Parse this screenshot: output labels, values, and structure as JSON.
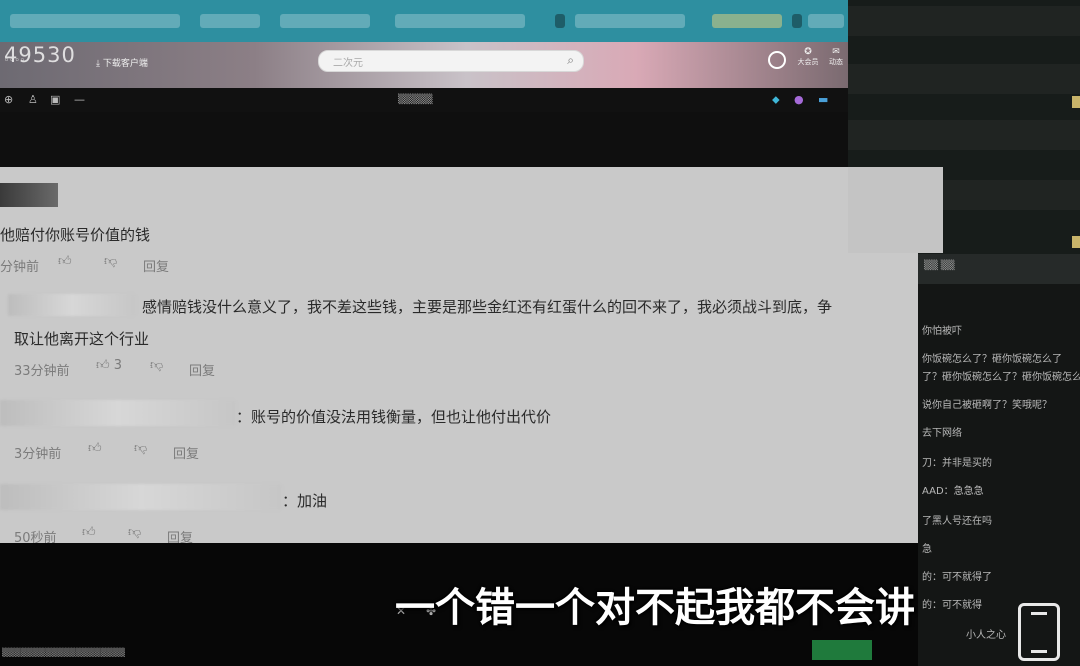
{
  "header": {
    "logo": "49530",
    "download_link": "下载客户端",
    "search_placeholder": "二次元",
    "icon_labels": [
      "大会员",
      "动态"
    ]
  },
  "comments": [
    {
      "text": "他赔付你账号价值的钱",
      "time": "分钟前",
      "likes": "",
      "reply_label": "回复"
    },
    {
      "text": "感情赔钱没什么意义了，我不差这些钱，主要是那些金红还有红蛋什么的回不来了，我必须战斗到底，争",
      "text_cont": "取让他离开这个行业",
      "time": "33分钟前",
      "likes": "3",
      "reply_label": "回复"
    },
    {
      "text": "：账号的价值没法用钱衡量，但也让他付出代价",
      "time": "3分钟前",
      "likes": "",
      "reply_label": "回复"
    },
    {
      "text": "：加油",
      "time": "50秒前",
      "likes": "",
      "reply_label": "回复"
    }
  ],
  "chat": {
    "messages": [
      "你怕被吓",
      "你饭碗怎么了？砸你饭碗怎么了",
      "了？砸你饭碗怎么了？砸你饭碗怎么",
      "说你自己被砸啊了？笑哦呢？",
      "去下网络",
      "刀：并非是买的",
      "AAD：急急急",
      "了黑人号还在吗",
      "急",
      "的：可不就得了",
      "的：可不就得",
      "小人之心"
    ]
  },
  "subtitle": "一个错一个对不起我都不会讲",
  "icons": {
    "like": "thumbs-up-icon",
    "dislike": "thumbs-down-icon",
    "search": "search-icon",
    "close": "close-icon",
    "phone": "phone-icon"
  }
}
